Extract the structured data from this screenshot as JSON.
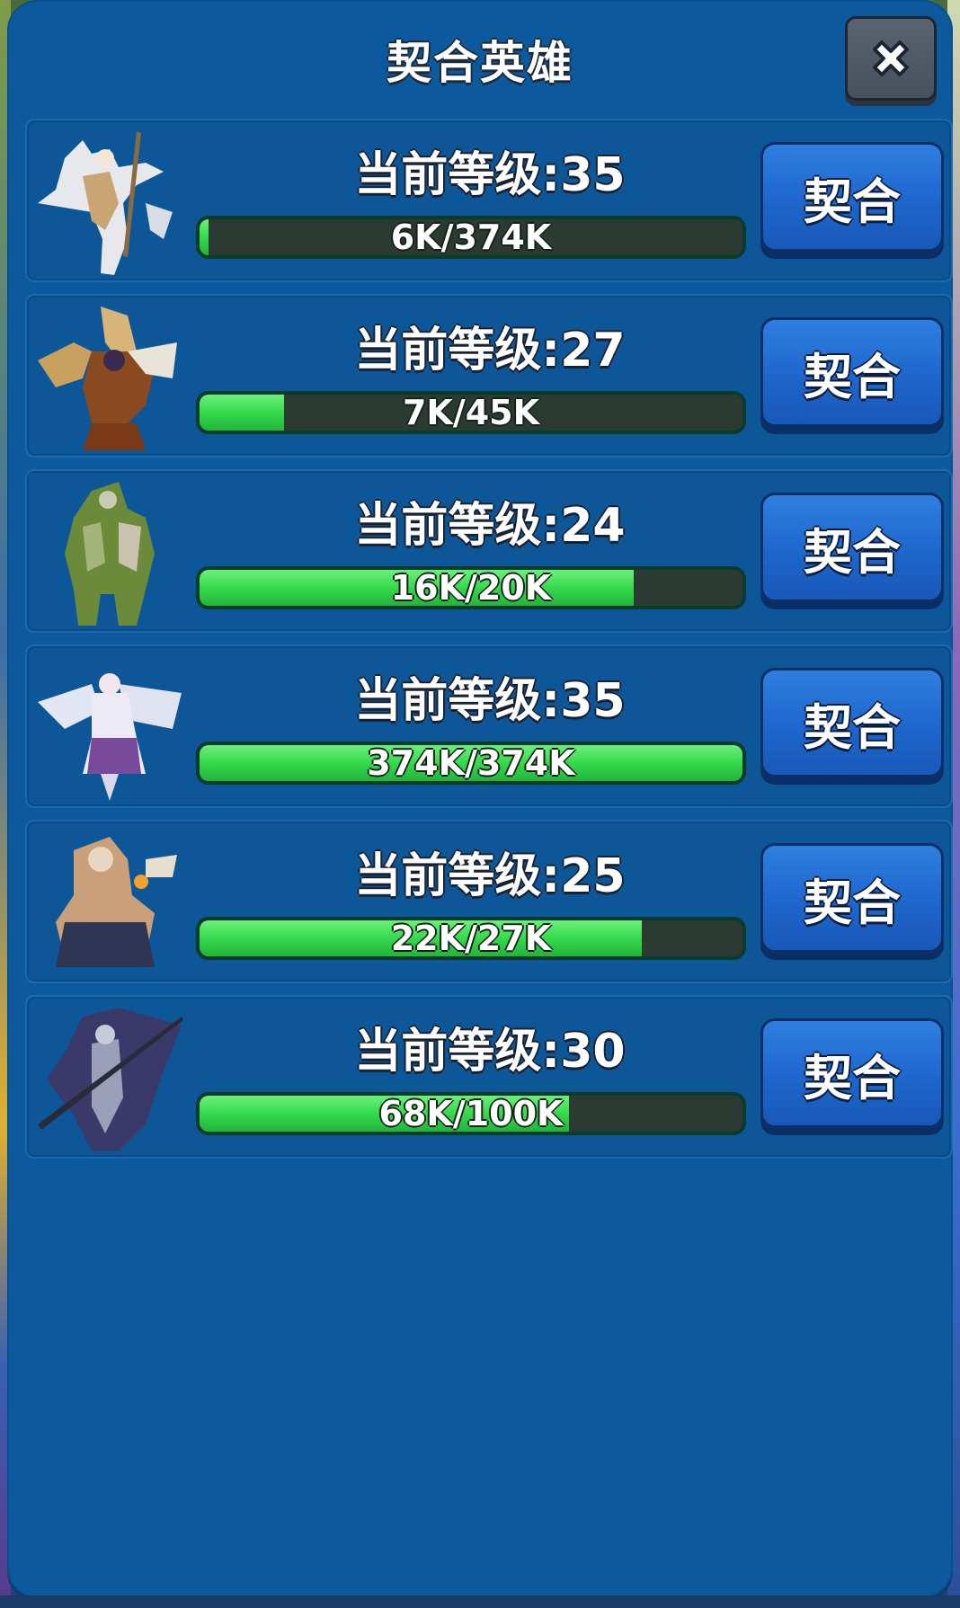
{
  "dialog": {
    "title": "契合英雄",
    "close_icon": "close-x-icon"
  },
  "heroes": [
    {
      "portrait": "hero-portrait-white-armored-knight",
      "level_label": "当前等级:35",
      "progress_label": "6K/374K",
      "progress_fraction": 0.016,
      "bond_label": "契合"
    },
    {
      "portrait": "hero-portrait-golden-winged-warrior",
      "level_label": "当前等级:27",
      "progress_label": "7K/45K",
      "progress_fraction": 0.156,
      "bond_label": "契合"
    },
    {
      "portrait": "hero-portrait-green-stone-golem",
      "level_label": "当前等级:24",
      "progress_label": "16K/20K",
      "progress_fraction": 0.8,
      "bond_label": "契合"
    },
    {
      "portrait": "hero-portrait-winged-maid",
      "level_label": "当前等级:35",
      "progress_label": "374K/374K",
      "progress_fraction": 1.0,
      "bond_label": "契合"
    },
    {
      "portrait": "hero-portrait-bearded-mage",
      "level_label": "当前等级:25",
      "progress_label": "22K/27K",
      "progress_fraction": 0.815,
      "bond_label": "契合"
    },
    {
      "portrait": "hero-portrait-dark-reaper",
      "level_label": "当前等级:30",
      "progress_label": "68K/100K",
      "progress_fraction": 0.68,
      "bond_label": "契合"
    }
  ],
  "colors": {
    "panel": "#0c5a9d",
    "progress_fill": "#35d94c",
    "progress_track": "#2b3a33",
    "bond_button": "#1e66cc"
  }
}
